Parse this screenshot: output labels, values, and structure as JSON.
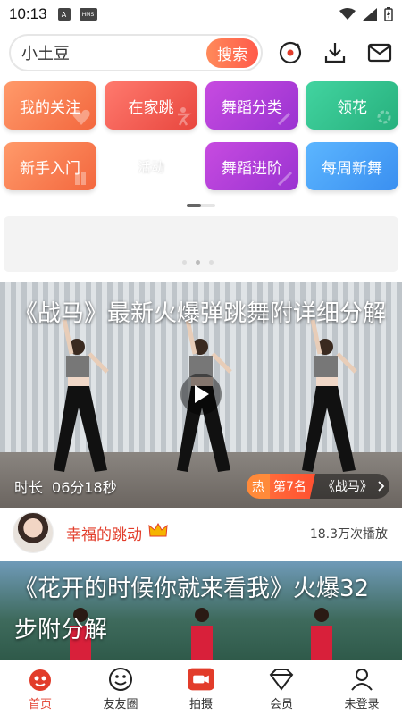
{
  "status_bar": {
    "time": "10:13",
    "chip_a": "A",
    "chip_hms": "HMS"
  },
  "search": {
    "value": "小土豆",
    "button_label": "搜索"
  },
  "categories": [
    {
      "label": "我的关注"
    },
    {
      "label": "在家跳"
    },
    {
      "label": "舞蹈分类"
    },
    {
      "label": "领花"
    },
    {
      "label": "新手入门"
    },
    {
      "label": "活动"
    },
    {
      "label": "舞蹈进阶"
    },
    {
      "label": "每周新舞"
    }
  ],
  "feed": [
    {
      "title": "《战马》最新火爆弹跳舞附详细分解",
      "duration_label": "时长",
      "duration": "06分18秒",
      "hot_label": "热",
      "rank": "第7名",
      "tag": "《战马》",
      "uploader": "幸福的跳动",
      "plays": "18.3万次播放"
    },
    {
      "title": "《花开的时候你就来看我》火爆32步附分解"
    }
  ],
  "bottom_nav": [
    {
      "label": "首页",
      "icon": "home-icon"
    },
    {
      "label": "友友圈",
      "icon": "smile-icon"
    },
    {
      "label": "拍摄",
      "icon": "camera-icon"
    },
    {
      "label": "会员",
      "icon": "diamond-icon"
    },
    {
      "label": "未登录",
      "icon": "user-icon"
    }
  ],
  "colors": {
    "accent": "#e23c2a",
    "search_button": "#ff6a4f"
  }
}
